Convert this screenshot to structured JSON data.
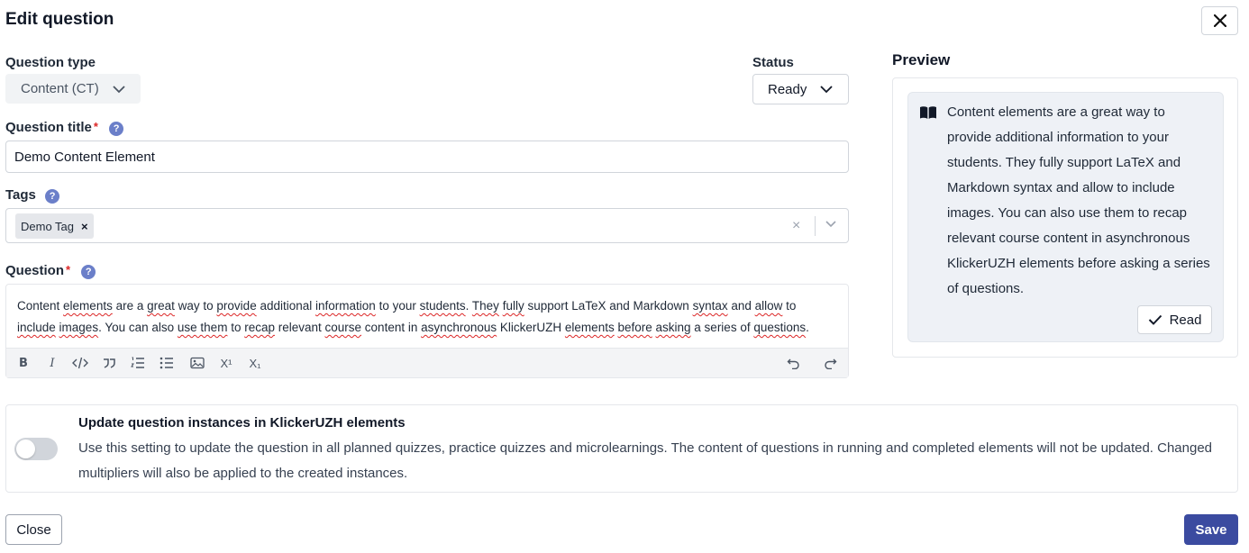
{
  "dialog": {
    "title": "Edit question"
  },
  "question_type": {
    "label": "Question type",
    "value": "Content (CT)"
  },
  "status": {
    "label": "Status",
    "value": "Ready"
  },
  "question_title": {
    "label": "Question title",
    "required_mark": "*",
    "help": "?",
    "value": "Demo Content Element"
  },
  "tags": {
    "label": "Tags",
    "help": "?",
    "items": [
      {
        "label": "Demo Tag",
        "remove": "×"
      }
    ],
    "clear": "×"
  },
  "question": {
    "label": "Question",
    "required_mark": "*",
    "help": "?",
    "text_segments": [
      {
        "t": "Content "
      },
      {
        "t": "elements",
        "u": true
      },
      {
        "t": " are a "
      },
      {
        "t": "great",
        "u": true
      },
      {
        "t": " way to "
      },
      {
        "t": "provide",
        "u": true
      },
      {
        "t": " additional "
      },
      {
        "t": "information",
        "u": true
      },
      {
        "t": " to your "
      },
      {
        "t": "students",
        "u": true
      },
      {
        "t": ". "
      },
      {
        "t": "They",
        "u": true
      },
      {
        "t": " "
      },
      {
        "t": "fully",
        "u": true
      },
      {
        "t": " support LaTeX and Markdown "
      },
      {
        "t": "syntax",
        "u": true
      },
      {
        "t": " and "
      },
      {
        "t": "allow",
        "u": true
      },
      {
        "t": " to "
      },
      {
        "t": "include",
        "u": true
      },
      {
        "t": " "
      },
      {
        "t": "images",
        "u": true
      },
      {
        "t": ". You can also "
      },
      {
        "t": "use them",
        "u": true
      },
      {
        "t": " to "
      },
      {
        "t": "recap",
        "u": true
      },
      {
        "t": " relevant "
      },
      {
        "t": "course",
        "u": true
      },
      {
        "t": " content in "
      },
      {
        "t": "asynchronous",
        "u": true
      },
      {
        "t": " KlickerUZH "
      },
      {
        "t": "elements",
        "u": true
      },
      {
        "t": " "
      },
      {
        "t": "before",
        "u": true
      },
      {
        "t": " "
      },
      {
        "t": "asking",
        "u": true
      },
      {
        "t": " a series of "
      },
      {
        "t": "questions",
        "u": true
      },
      {
        "t": "."
      }
    ],
    "toolbar": {
      "bold": "B",
      "italic": "I",
      "superscript": "X¹",
      "subscript": "X₁"
    }
  },
  "preview": {
    "title": "Preview",
    "text": "Content elements are a great way to provide additional information to your students. They fully support LaTeX and Markdown syntax and allow to include images. You can also use them to recap relevant course content in asynchronous KlickerUZH elements before asking a series of questions.",
    "read_label": "Read"
  },
  "update_setting": {
    "title": "Update question instances in KlickerUZH elements",
    "description": "Use this setting to update the question in all planned quizzes, practice quizzes and microlearnings. The content of questions in running and completed elements will not be updated. Changed multipliers will also be applied to the created instances.",
    "enabled": false
  },
  "footer": {
    "close_label": "Close",
    "save_label": "Save"
  }
}
